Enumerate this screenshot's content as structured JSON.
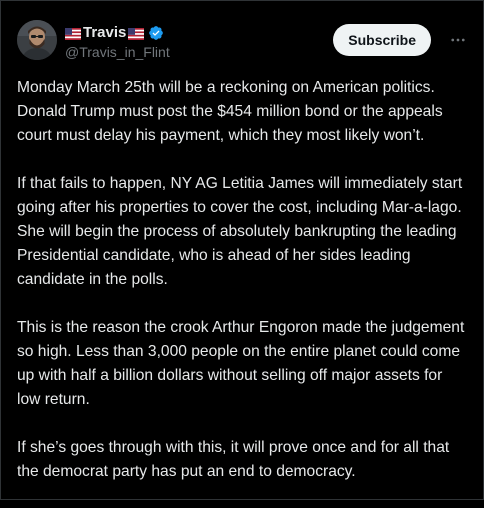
{
  "author": {
    "display_name": "Travis",
    "handle": "@Travis_in_Flint",
    "verified": true,
    "name_decoration": "us-flag-icon"
  },
  "header": {
    "subscribe_label": "Subscribe",
    "more_icon": "more-horizontal-icon"
  },
  "post": {
    "paragraphs": [
      "Monday March 25th will be a reckoning on American politics. Donald Trump must post the $454 million bond or the appeals court must delay his payment, which they most likely won’t.",
      "If that fails to happen, NY AG Letitia James will immediately start going after his properties to cover the cost, including Mar-a-lago. She will begin the process of absolutely bankrupting the leading Presidential candidate, who is ahead of her sides leading candidate in the polls.",
      "This is the reason the crook Arthur Engoron made the judgement so high.  Less than 3,000 people on the entire planet could come up with half a billion dollars without selling off major assets for low return.",
      "If she’s goes through with this, it will prove once and for all that the democrat party has put an end to democracy."
    ]
  },
  "colors": {
    "background": "#000000",
    "text_primary": "#e7e9ea",
    "text_secondary": "#71767b",
    "verified_badge": "#1d9bf0",
    "subscribe_bg": "#eff3f4"
  }
}
